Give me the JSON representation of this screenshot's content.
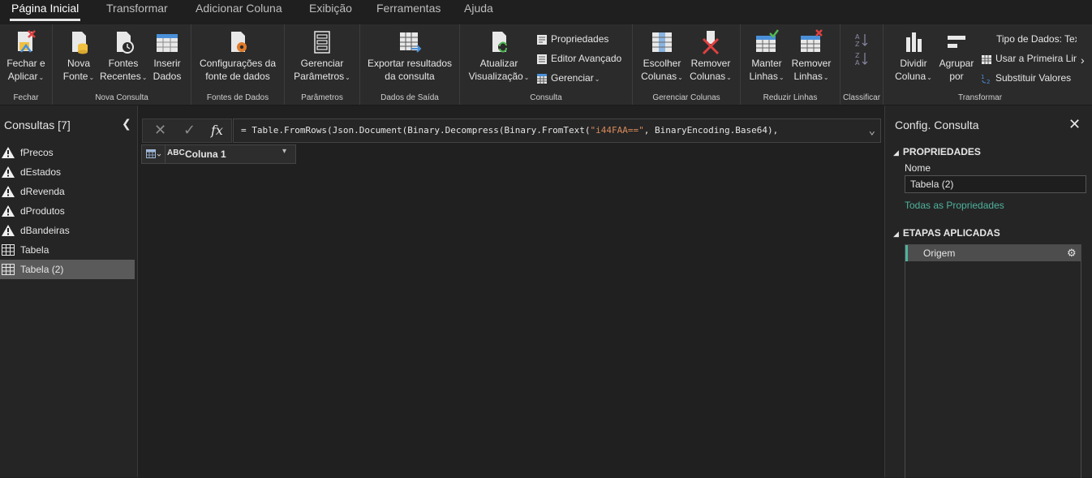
{
  "menu": {
    "tabs": [
      "Página Inicial",
      "Transformar",
      "Adicionar Coluna",
      "Exibição",
      "Ferramentas",
      "Ajuda"
    ]
  },
  "ribbon": {
    "groups": {
      "fechar": "Fechar",
      "nova_consulta": "Nova Consulta",
      "fontes_dados": "Fontes de Dados",
      "parametros": "Parâmetros",
      "dados_saida": "Dados de Saída",
      "consulta": "Consulta",
      "gerenciar_colunas": "Gerenciar Colunas",
      "reduzir_linhas": "Reduzir Linhas",
      "classificar": "Classificar",
      "transformar": "Transformar"
    },
    "buttons": {
      "fechar_aplicar": [
        "Fechar e",
        "Aplicar"
      ],
      "nova_fonte": [
        "Nova",
        "Fonte"
      ],
      "fontes_recentes": [
        "Fontes",
        "Recentes"
      ],
      "inserir_dados": [
        "Inserir",
        "Dados"
      ],
      "config_fonte": [
        "Configurações da",
        "fonte de dados"
      ],
      "gerenciar_parametros": [
        "Gerenciar",
        "Parâmetros"
      ],
      "exportar": [
        "Exportar resultados",
        "da consulta"
      ],
      "atualizar": [
        "Atualizar",
        "Visualização"
      ],
      "propriedades": "Propriedades",
      "editor_avancado": "Editor Avançado",
      "gerenciar": "Gerenciar",
      "escolher_colunas": [
        "Escolher",
        "Colunas"
      ],
      "remover_colunas": [
        "Remover",
        "Colunas"
      ],
      "manter_linhas": [
        "Manter",
        "Linhas"
      ],
      "remover_linhas": [
        "Remover",
        "Linhas"
      ],
      "dividir_coluna": [
        "Dividir",
        "Coluna"
      ],
      "agrupar_por": [
        "Agrupar",
        "por"
      ],
      "tipo_dados": "Tipo de Dados: Tex",
      "usar_primeira": "Usar a Primeira Lin",
      "substituir": "Substituir Valores"
    },
    "scroll_right": "›"
  },
  "queries": {
    "title": "Consultas [7]",
    "items": [
      {
        "label": "fPrecos",
        "icon": "warning-icon"
      },
      {
        "label": "dEstados",
        "icon": "warning-icon"
      },
      {
        "label": "dRevenda",
        "icon": "warning-icon"
      },
      {
        "label": "dProdutos",
        "icon": "warning-icon"
      },
      {
        "label": "dBandeiras",
        "icon": "warning-icon"
      },
      {
        "label": "Tabela",
        "icon": "table-icon"
      },
      {
        "label": "Tabela (2)",
        "icon": "table-icon",
        "selected": true
      }
    ]
  },
  "formula": {
    "prefix": "= Table.FromRows(Json.Document(Binary.Decompress(Binary.FromText(",
    "string": "\"i44FAA==\"",
    "suffix": ", BinaryEncoding.Base64),",
    "fx": "fx"
  },
  "grid": {
    "column": "Coluna 1",
    "type_label": "ABC"
  },
  "settings": {
    "title": "Config. Consulta",
    "properties_header": "PROPRIEDADES",
    "name_label": "Nome",
    "name_value": "Tabela (2)",
    "all_properties": "Todas as Propriedades",
    "steps_header": "ETAPAS APLICADAS",
    "steps": [
      "Origem"
    ]
  },
  "colors": {
    "accent": "#4fb39d",
    "background": "#1f1f1f",
    "ribbon": "#2b2b2b",
    "selected": "#5a5a5a"
  }
}
